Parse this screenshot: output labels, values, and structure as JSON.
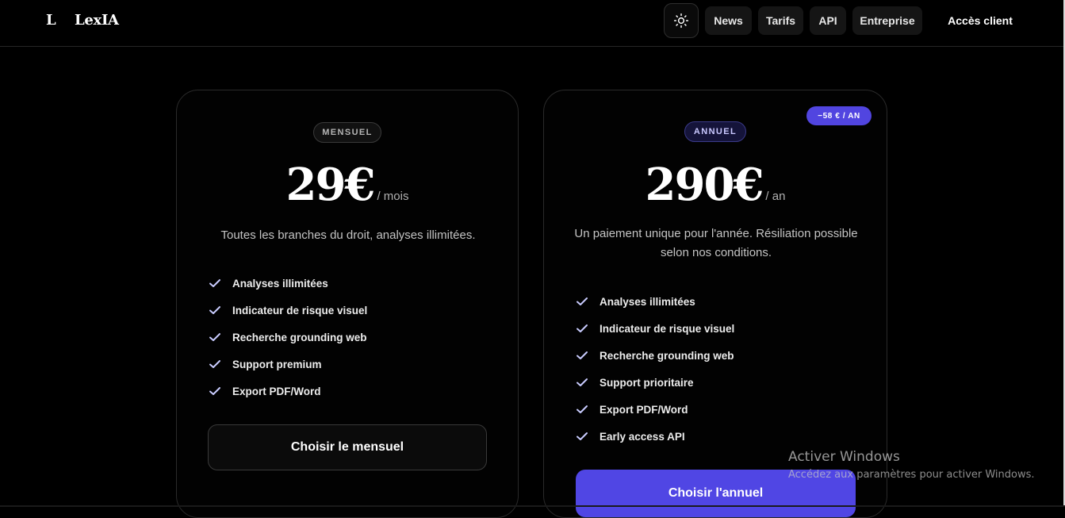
{
  "header": {
    "logo_mark": "L",
    "logo_text": "LexIA",
    "nav": [
      "News",
      "Tarifs",
      "API",
      "Entreprise"
    ],
    "access": "Accès client",
    "theme_icon": "sun-icon"
  },
  "plans": {
    "monthly": {
      "pill": "MENSUEL",
      "amount": "29€",
      "unit": "/ mois",
      "description": "Toutes les branches du droit, analyses illimitées.",
      "features": [
        "Analyses illimitées",
        "Indicateur de risque visuel",
        "Recherche grounding web",
        "Support premium",
        "Export PDF/Word"
      ],
      "cta": "Choisir le mensuel"
    },
    "annual": {
      "pill": "ANNUEL",
      "badge": "−58 € / AN",
      "amount": "290€",
      "unit": "/ an",
      "description": "Un paiement unique pour l'année. Résiliation possible selon nos conditions.",
      "features": [
        "Analyses illimitées",
        "Indicateur de risque visuel",
        "Recherche grounding web",
        "Support prioritaire",
        "Export PDF/Word",
        "Early access API"
      ],
      "cta": "Choisir l'annuel"
    }
  },
  "watermark": {
    "title": "Activer Windows",
    "subtitle": "Accédez aux paramètres pour activer Windows."
  },
  "colors": {
    "background": "#000000",
    "accent": "#5046e4",
    "check": "#c9ccff"
  }
}
